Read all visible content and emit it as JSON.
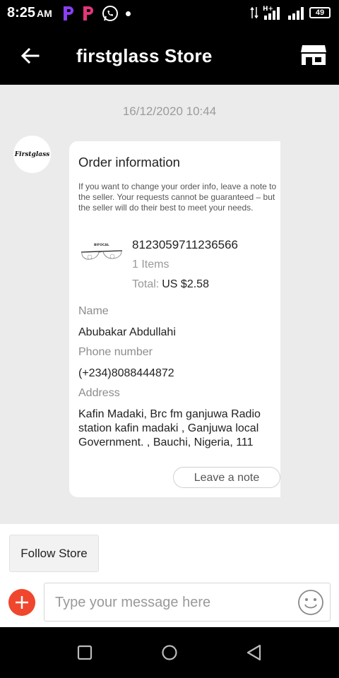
{
  "status_bar": {
    "time": "8:25",
    "ampm": "AM",
    "network": "H+",
    "battery": "49"
  },
  "header": {
    "title": "firstglass Store",
    "icons": {
      "back": "back-arrow-icon",
      "store": "store-icon"
    }
  },
  "chat": {
    "timestamp": "16/12/2020 10:44",
    "avatar_text": "Firstglass"
  },
  "order_card": {
    "title": "Order information",
    "note": "If you want to change your order info, leave a note to the seller. Your requests cannot be guaranteed – but the seller will do their best to meet your needs.",
    "product_label": "BIFOCAL",
    "order_number": "8123059711236566",
    "items": "1 Items",
    "total_label": "Total:",
    "total_value": "US $2.58",
    "name_label": "Name",
    "name_value": "Abubakar Abdullahi",
    "phone_label": "Phone number",
    "phone_value": "(+234)8088444872",
    "address_label": "Address",
    "address_value": "Kafin Madaki, Brc fm ganjuwa Radio station kafin madaki , Ganjuwa local Government. , Bauchi, Nigeria, 111",
    "leave_note_label": "Leave a note"
  },
  "bottom": {
    "follow_label": "Follow Store",
    "message_placeholder": "Type your message here"
  },
  "colors": {
    "accent": "#f0462d",
    "header_bg": "#000000",
    "chat_bg": "#ebebeb"
  }
}
